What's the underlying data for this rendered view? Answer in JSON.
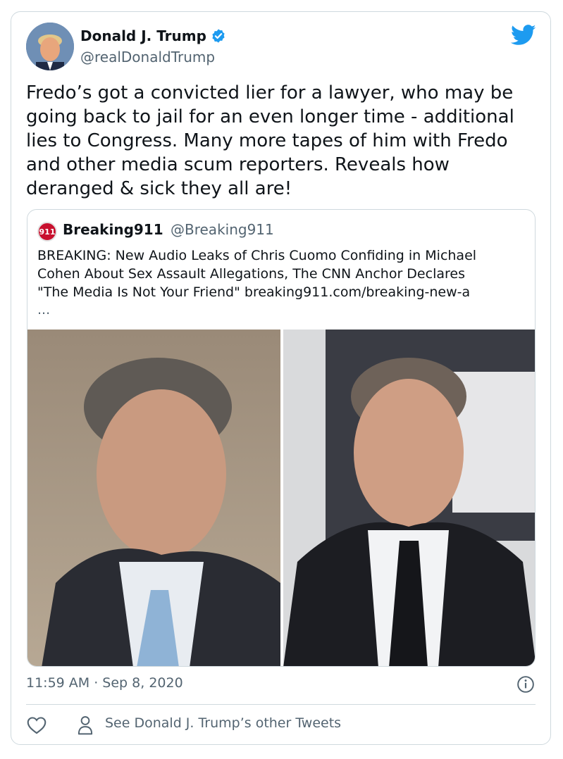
{
  "tweet": {
    "author_name": "Donald J. Trump",
    "author_handle": "@realDonaldTrump",
    "text": "Fredo’s got a convicted lier for a lawyer, who may be\ngoing back to jail for an even longer time - additional\nlies to Congress. Many more tapes of him with Fredo\nand other media scum reporters. Reveals how\nderanged & sick they all are!",
    "timestamp": "11:59 AM · Sep 8, 2020"
  },
  "quoted_tweet": {
    "avatar_text": "911",
    "author_name": "Breaking911",
    "author_handle": "@Breaking911",
    "text": "BREAKING: New Audio Leaks of Chris Cuomo Confiding in Michael\nCohen About Sex Assault Allegations, The CNN Anchor Declares\n\"The Media Is Not Your Friend\"  breaking911.com/breaking-new-a",
    "more": "..."
  },
  "footer": {
    "other_tweets_label": "See Donald J. Trump’s other Tweets"
  },
  "icons": {
    "verified": "verified-badge-icon",
    "brand": "twitter-bird-icon",
    "info": "info-icon",
    "like": "heart-icon",
    "profile": "person-icon"
  },
  "colors": {
    "brand_blue": "#1d9bf0",
    "secondary_text": "#536471",
    "border": "#cfd9de",
    "breaking_red": "#c8102e"
  }
}
